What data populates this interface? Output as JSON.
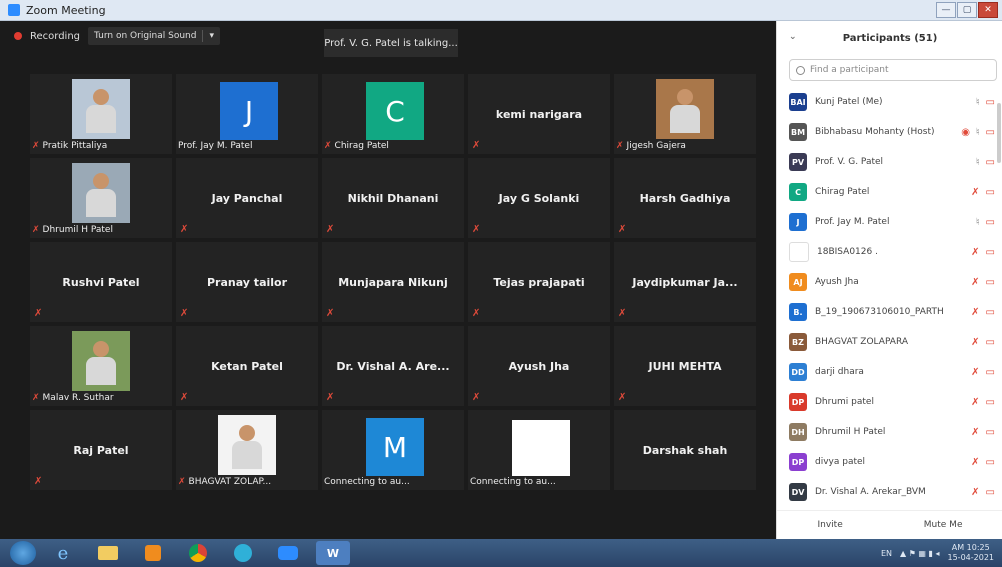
{
  "window": {
    "title": "Zoom Meeting"
  },
  "toolbar": {
    "recording_label": "Recording",
    "original_sound_label": "Turn on Original Sound"
  },
  "talking_banner": "Prof. V. G. Patel is talking...",
  "tiles": [
    {
      "type": "photo",
      "label": "Pratik Pittaliya",
      "muted": true,
      "color": "#b9c7d6"
    },
    {
      "type": "avatar",
      "letter": "J",
      "avatar_color": "#1e6fd1",
      "label": "Prof. Jay M. Patel",
      "muted": false
    },
    {
      "type": "avatar",
      "letter": "C",
      "avatar_color": "#11a883",
      "label": "Chirag Patel",
      "muted": true
    },
    {
      "type": "name",
      "name": "kemi narigara",
      "muted": true
    },
    {
      "type": "photo",
      "label": "Jigesh Gajera",
      "muted": true,
      "color": "#a9774a"
    },
    {
      "type": "photo",
      "label": "Dhrumil H Patel",
      "muted": true,
      "color": "#9aa9b6"
    },
    {
      "type": "name",
      "name": "Jay Panchal",
      "muted": true
    },
    {
      "type": "name",
      "name": "Nikhil Dhanani",
      "muted": true
    },
    {
      "type": "name",
      "name": "Jay G Solanki",
      "muted": true
    },
    {
      "type": "name",
      "name": "Harsh Gadhiya",
      "muted": true
    },
    {
      "type": "name",
      "name": "Rushvi Patel",
      "muted": true
    },
    {
      "type": "name",
      "name": "Pranay tailor",
      "muted": true
    },
    {
      "type": "name",
      "name": "Munjapara Nikunj",
      "muted": true
    },
    {
      "type": "name",
      "name": "Tejas prajapati",
      "muted": true
    },
    {
      "type": "name",
      "name": "Jaydipkumar  Ja...",
      "muted": true
    },
    {
      "type": "photo",
      "label": "Malav R. Suthar",
      "muted": true,
      "color": "#7b9a5a"
    },
    {
      "type": "name",
      "name": "Ketan Patel",
      "muted": true
    },
    {
      "type": "name",
      "name": "Dr. Vishal A. Are...",
      "muted": true
    },
    {
      "type": "name",
      "name": "Ayush Jha",
      "muted": true
    },
    {
      "type": "name",
      "name": "JUHI MEHTA",
      "muted": true
    },
    {
      "type": "name",
      "name": "Raj Patel",
      "muted": true
    },
    {
      "type": "photo",
      "label": "BHAGVAT ZOLAP...",
      "muted": true,
      "color": "#f3f3f3"
    },
    {
      "type": "avatar",
      "letter": "M",
      "avatar_color": "#1e88d6",
      "label": "Connecting to au...",
      "muted": false
    },
    {
      "type": "white",
      "label": "Connecting to au...",
      "muted": false
    },
    {
      "type": "name",
      "name": "Darshak shah",
      "muted": false
    }
  ],
  "participants": {
    "title": "Participants (51)",
    "search_placeholder": "Find a participant",
    "list": [
      {
        "name": "Kunj Patel (Me)",
        "initials": "BAI",
        "color": "#1b3f8f",
        "mic": "on"
      },
      {
        "name": "Bibhabasu Mohanty (Host)",
        "initials": "BM",
        "color": "#555555",
        "mic": "on",
        "host": true
      },
      {
        "name": "Prof. V. G. Patel",
        "initials": "PV",
        "color": "#3b3b55",
        "mic": "on"
      },
      {
        "name": "Chirag Patel",
        "initials": "C",
        "color": "#11a883",
        "mic": "off"
      },
      {
        "name": "Prof. Jay M. Patel",
        "initials": "J",
        "color": "#1e6fd1",
        "mic": "on"
      },
      {
        "name": "18BISA0126 .",
        "initials": "",
        "color": "#ffffff",
        "mic": "off"
      },
      {
        "name": "Ayush Jha",
        "initials": "AJ",
        "color": "#f08c1e",
        "mic": "off"
      },
      {
        "name": "B_19_190673106010_PARTH",
        "initials": "B.",
        "color": "#1e6fd1",
        "mic": "off"
      },
      {
        "name": "BHAGVAT ZOLAPARA",
        "initials": "BZ",
        "color": "#8a5a3a",
        "mic": "off"
      },
      {
        "name": "darji dhara",
        "initials": "DD",
        "color": "#2d7fd3",
        "mic": "off"
      },
      {
        "name": "Dhrumi patel",
        "initials": "DP",
        "color": "#d93a2b",
        "mic": "off"
      },
      {
        "name": "Dhrumil H Patel",
        "initials": "DH",
        "color": "#8e7b62",
        "mic": "off"
      },
      {
        "name": "divya patel",
        "initials": "DP",
        "color": "#8b3fd0",
        "mic": "off"
      },
      {
        "name": "Dr. Vishal A. Arekar_BVM",
        "initials": "DV",
        "color": "#333a44",
        "mic": "off"
      }
    ],
    "invite_label": "Invite",
    "mute_me_label": "Mute Me"
  },
  "taskbar": {
    "lang": "EN",
    "time": "AM 10:25",
    "date": "15-04-2021"
  }
}
